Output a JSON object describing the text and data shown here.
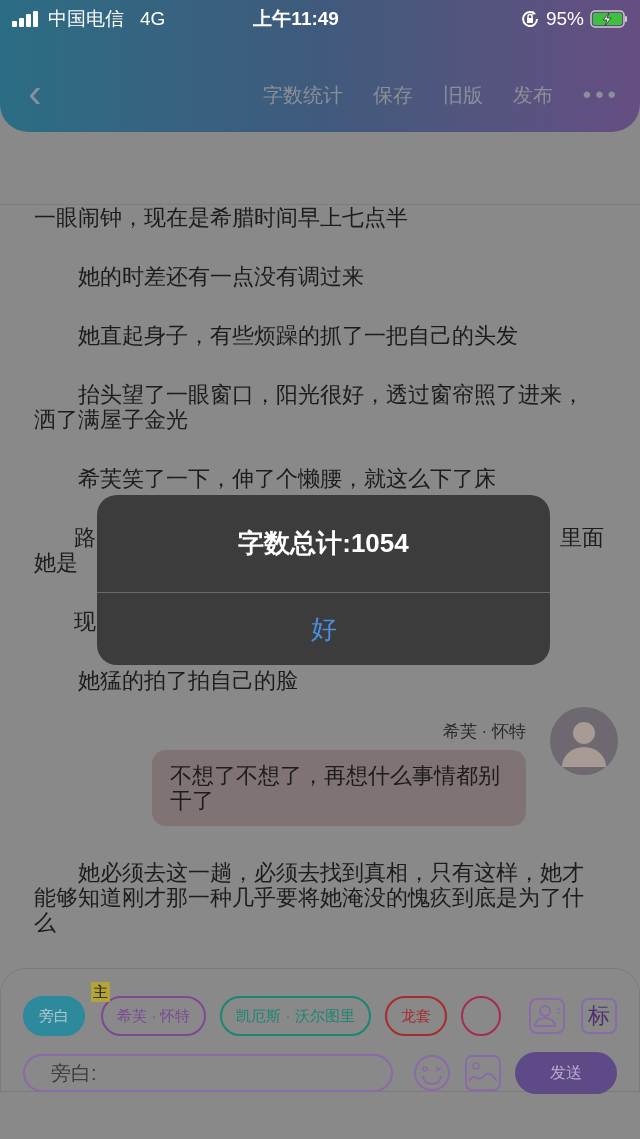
{
  "status_bar": {
    "carrier": "中国电信",
    "network": "4G",
    "time": "上午11:49",
    "battery": "95%"
  },
  "nav": {
    "back": "‹",
    "actions": [
      "字数统计",
      "保存",
      "旧版",
      "发布"
    ],
    "more": "•••"
  },
  "content": [
    {
      "kind": "para",
      "text": "一眼闹钟，现在是希腊时间早上七点半",
      "indent": false
    },
    {
      "kind": "para",
      "text": "她的时差还有一点没有调过来",
      "indent": true
    },
    {
      "kind": "para",
      "text": "她直起身子，有些烦躁的抓了一把自己的头发",
      "indent": true
    },
    {
      "kind": "para",
      "text": "抬头望了一眼窗口，阳光很好，透过窗帘照了进来，洒了满屋子金光",
      "indent": true
    },
    {
      "kind": "para",
      "text": "希芙笑了一下，伸了个懒腰，就这么下了床",
      "indent": true
    },
    {
      "kind": "covered",
      "lines": [
        {
          "left": "路",
          "right": "里面"
        },
        {
          "left": "她是"
        }
      ]
    },
    {
      "kind": "covered",
      "lines": [
        {
          "left": "现"
        }
      ]
    },
    {
      "kind": "para",
      "text": "她猛的拍了拍自己的脸",
      "indent": true
    },
    {
      "kind": "chat",
      "speaker": "希芙 · 怀特",
      "text": "不想了不想了，再想什么事情都别干了"
    },
    {
      "kind": "para",
      "text": "她必须去这一趟，必须去找到真相，只有这样，她才能够知道刚才那一种几乎要将她淹没的愧疚到底是为了什么",
      "indent": true
    }
  ],
  "alert": {
    "title": "字数总计:1054",
    "button": "好"
  },
  "composer": {
    "roles": [
      {
        "label": "旁白",
        "selected": true,
        "color": "#2c8a9c"
      },
      {
        "label": "希芙 · 怀特",
        "selected": false,
        "color": "#7a4a94",
        "badge": "主"
      },
      {
        "label": "凯厄斯 · 沃尔图里",
        "selected": false,
        "color": "#1d8574"
      },
      {
        "label": "龙套",
        "selected": false,
        "color": "#a82a2a"
      },
      {
        "selected": false,
        "color": "#a82a55"
      }
    ],
    "tag_button": "标",
    "placeholder": "旁白:",
    "send": "发送"
  }
}
